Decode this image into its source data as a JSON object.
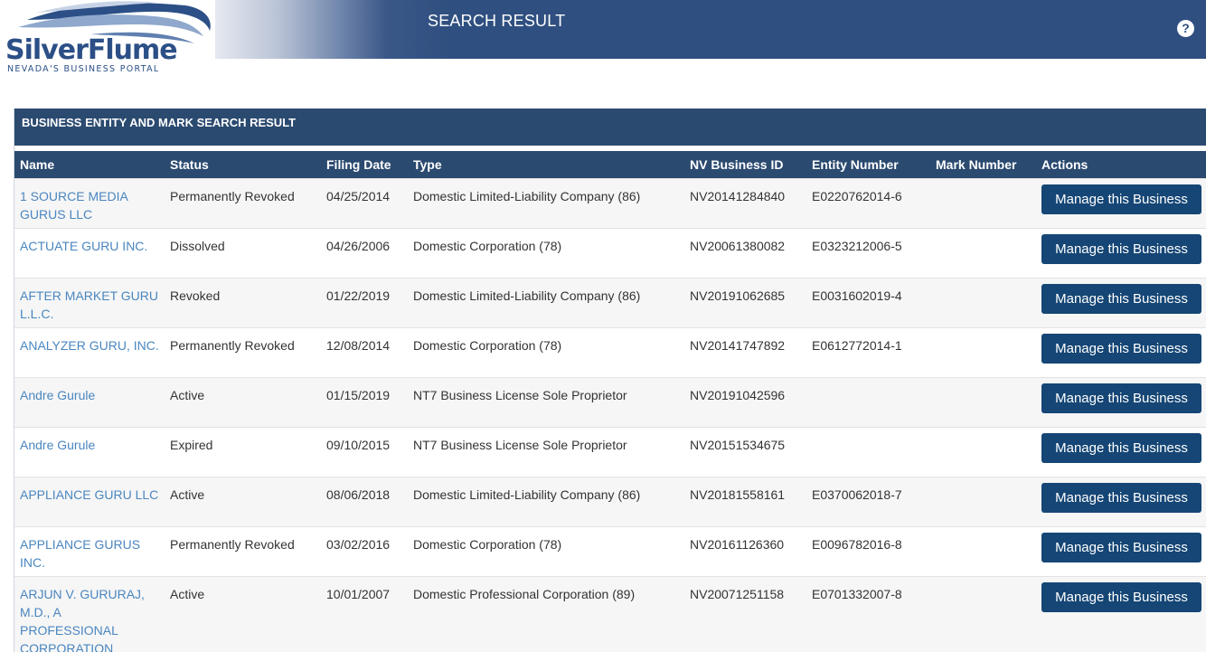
{
  "header": {
    "logo_text": "SilverFlume",
    "logo_tagline": "NEVADA'S BUSINESS PORTAL",
    "page_heading": "SEARCH RESULT",
    "help_icon": "question-circle-icon"
  },
  "panel": {
    "title": "BUSINESS ENTITY AND MARK SEARCH RESULT",
    "columns": [
      "Name",
      "Status",
      "Filing Date",
      "Type",
      "NV Business ID",
      "Entity Number",
      "Mark Number",
      "Actions"
    ],
    "rows": [
      {
        "name": "1 SOURCE MEDIA GURUS LLC",
        "status": "Permanently Revoked",
        "filing_date": "04/25/2014",
        "type": "Domestic Limited-Liability Company (86)",
        "nv_business_id": "NV20141284840",
        "entity_number": "E0220762014-6",
        "mark_number": "",
        "action": "Manage this Business"
      },
      {
        "name": "ACTUATE GURU INC.",
        "status": "Dissolved",
        "filing_date": "04/26/2006",
        "type": "Domestic Corporation (78)",
        "nv_business_id": "NV20061380082",
        "entity_number": "E0323212006-5",
        "mark_number": "",
        "action": "Manage this Business"
      },
      {
        "name": "AFTER MARKET GURU L.L.C.",
        "status": "Revoked",
        "filing_date": "01/22/2019",
        "type": "Domestic Limited-Liability Company (86)",
        "nv_business_id": "NV20191062685",
        "entity_number": "E0031602019-4",
        "mark_number": "",
        "action": "Manage this Business"
      },
      {
        "name": "ANALYZER GURU, INC.",
        "status": "Permanently Revoked",
        "filing_date": "12/08/2014",
        "type": "Domestic Corporation (78)",
        "nv_business_id": "NV20141747892",
        "entity_number": "E0612772014-1",
        "mark_number": "",
        "action": "Manage this Business"
      },
      {
        "name": "Andre Gurule",
        "status": "Active",
        "filing_date": "01/15/2019",
        "type": "NT7 Business License Sole Proprietor",
        "nv_business_id": "NV20191042596",
        "entity_number": "",
        "mark_number": "",
        "action": "Manage this Business"
      },
      {
        "name": "Andre Gurule",
        "status": "Expired",
        "filing_date": "09/10/2015",
        "type": "NT7 Business License Sole Proprietor",
        "nv_business_id": "NV20151534675",
        "entity_number": "",
        "mark_number": "",
        "action": "Manage this Business"
      },
      {
        "name": "APPLIANCE GURU LLC",
        "status": "Active",
        "filing_date": "08/06/2018",
        "type": "Domestic Limited-Liability Company (86)",
        "nv_business_id": "NV20181558161",
        "entity_number": "E0370062018-7",
        "mark_number": "",
        "action": "Manage this Business"
      },
      {
        "name": "APPLIANCE GURUS INC.",
        "status": "Permanently Revoked",
        "filing_date": "03/02/2016",
        "type": "Domestic Corporation (78)",
        "nv_business_id": "NV20161126360",
        "entity_number": "E0096782016-8",
        "mark_number": "",
        "action": "Manage this Business"
      },
      {
        "name": "ARJUN V. GURURAJ, M.D., A PROFESSIONAL CORPORATION",
        "status": "Active",
        "filing_date": "10/01/2007",
        "type": "Domestic Professional Corporation (89)",
        "nv_business_id": "NV20071251158",
        "entity_number": "E0701332007-8",
        "mark_number": "",
        "action": "Manage this Business"
      }
    ]
  },
  "colors": {
    "banner": "#2f4f80",
    "table_header": "#2b4a70",
    "button": "#154675",
    "link": "#4a86bf"
  }
}
